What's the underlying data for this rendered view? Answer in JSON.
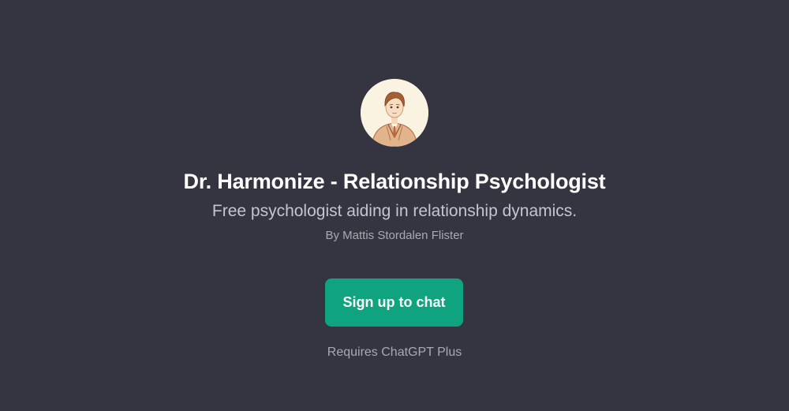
{
  "gpt": {
    "title": "Dr. Harmonize - Relationship Psychologist",
    "description": "Free psychologist aiding in relationship dynamics.",
    "author": "By Mattis Stordalen Flister",
    "avatar_icon": "psychologist-portrait-icon"
  },
  "cta": {
    "label": "Sign up to chat"
  },
  "footer": {
    "requirement": "Requires ChatGPT Plus"
  },
  "colors": {
    "background": "#343541",
    "accent": "#10a37f",
    "avatar_background": "#fbf3e2"
  }
}
